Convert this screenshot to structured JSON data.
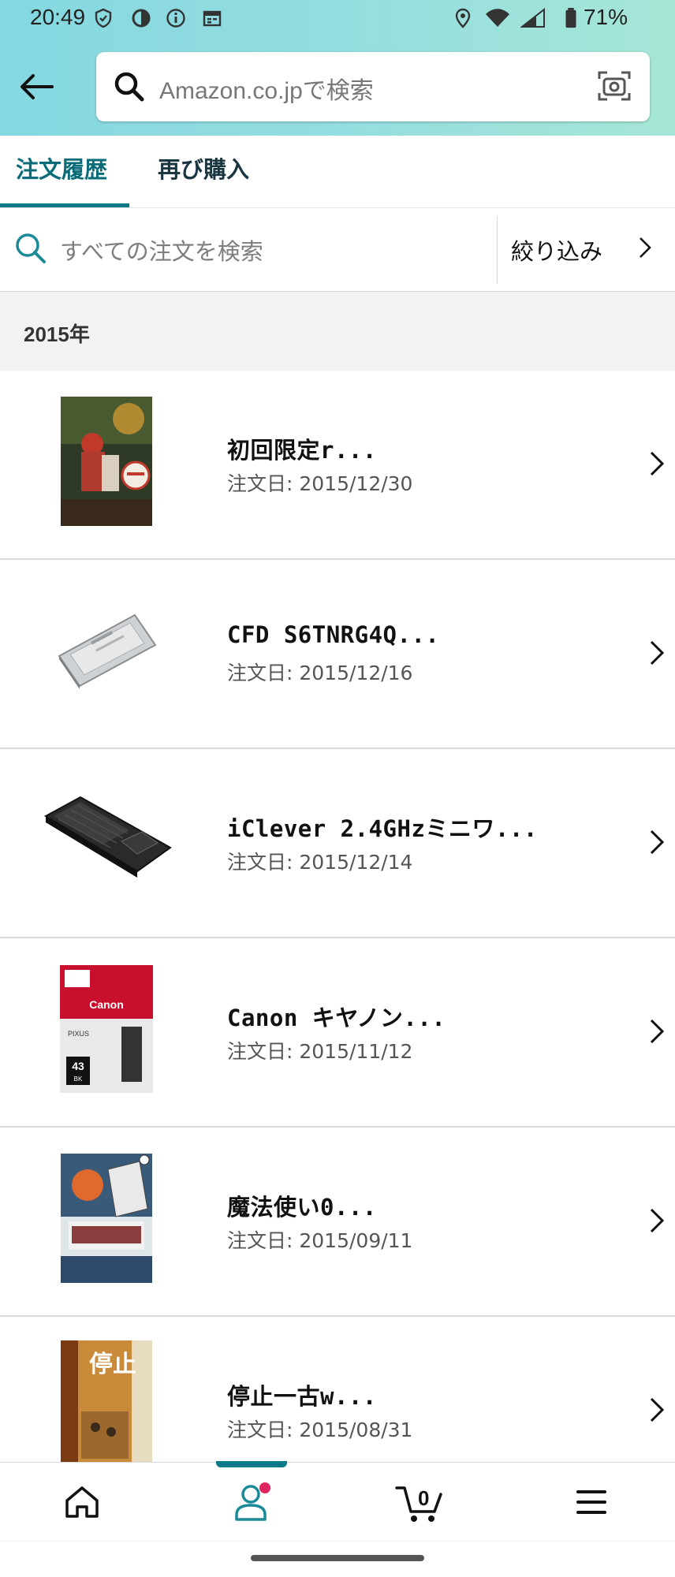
{
  "status_bar": {
    "time": "20:49",
    "battery": "71%"
  },
  "search": {
    "placeholder": "Amazon.co.jpで検索"
  },
  "tabs": [
    {
      "label": "注文履歴",
      "active": true
    },
    {
      "label": "再び購入",
      "active": false
    }
  ],
  "order_search": {
    "placeholder": "すべての注文を検索",
    "filter_label": "絞り込み"
  },
  "year_header": "2015年",
  "orders": [
    {
      "title": "初回限定r...",
      "date": "注文日: 2015/12/30",
      "thumb_icon": "manga-cover-thumbnail"
    },
    {
      "title": "CFD S6TNRG4Q...",
      "date": "注文日: 2015/12/16",
      "thumb_icon": "ssd-drive-thumbnail"
    },
    {
      "title": "iClever 2.4GHzミニワ...",
      "date": "注文日: 2015/12/14",
      "thumb_icon": "mini-keyboard-thumbnail"
    },
    {
      "title": "Canon キヤノン...",
      "date": "注文日: 2015/11/12",
      "thumb_icon": "ink-cartridge-thumbnail"
    },
    {
      "title": "魔法使い0...",
      "date": "注文日: 2015/09/11",
      "thumb_icon": "manga-cover-thumbnail"
    },
    {
      "title": "停止一古w...",
      "date": "注文日: 2015/08/31",
      "thumb_icon": "book-cover-thumbnail"
    }
  ],
  "ink_box": {
    "brand": "Canon",
    "series": "PIXUS",
    "model": "43",
    "color_code": "BK"
  },
  "book_cover_text": "停止",
  "bottom_nav": {
    "cart_count": "0",
    "items": [
      "home-icon",
      "account-icon",
      "cart-icon",
      "menu-icon"
    ]
  },
  "colors": {
    "accent": "#0a7a88",
    "header_gradient_start": "#84d8e0",
    "header_gradient_end": "#a6e6d6",
    "notification_dot": "#e0245e"
  }
}
